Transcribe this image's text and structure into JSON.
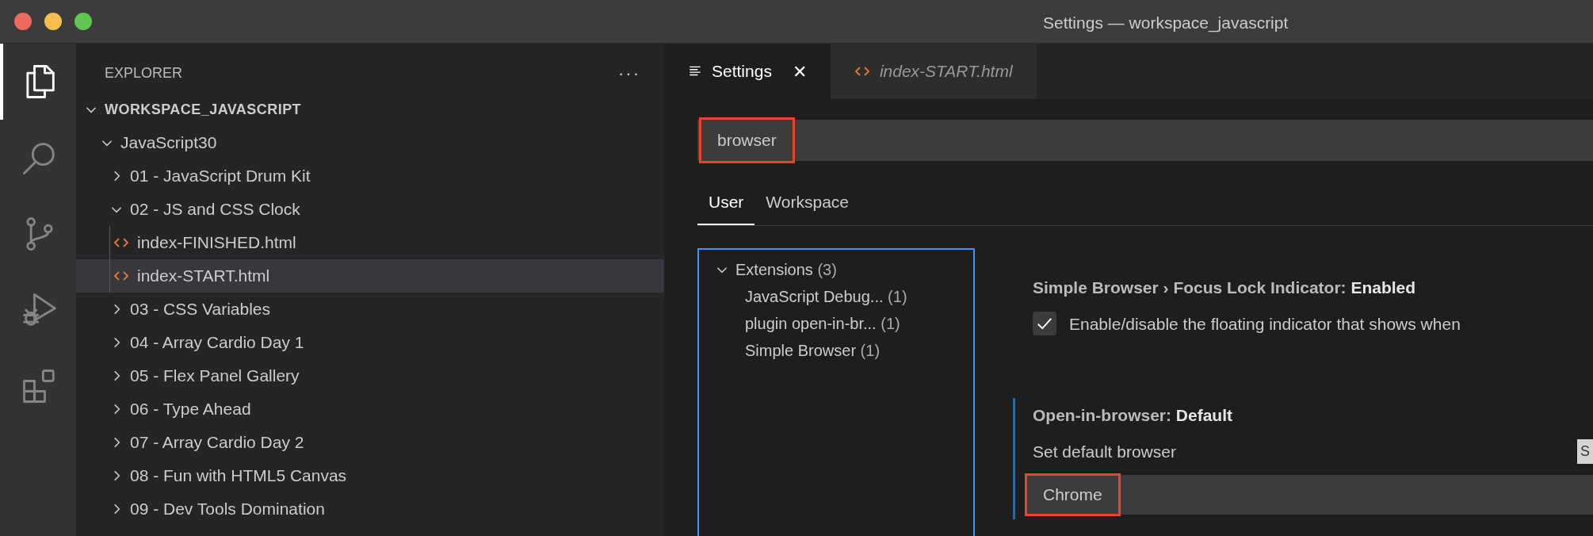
{
  "window": {
    "title": "Settings — workspace_javascript"
  },
  "activity_bar": [
    {
      "kind": "files",
      "selected": true
    },
    {
      "kind": "search",
      "selected": false
    },
    {
      "kind": "scm",
      "selected": false
    },
    {
      "kind": "debug",
      "selected": false
    },
    {
      "kind": "extensions",
      "selected": false
    }
  ],
  "explorer": {
    "title": "EXPLORER",
    "more": "···",
    "tree": [
      {
        "label": "WORKSPACE_JAVASCRIPT",
        "kind": "root",
        "expanded": true,
        "selected": false,
        "children": [
          {
            "label": "JavaScript30",
            "kind": "folder",
            "expanded": true,
            "selected": false,
            "children": [
              {
                "label": "01 - JavaScript Drum Kit",
                "kind": "folder",
                "expanded": false,
                "selected": false
              },
              {
                "label": "02 - JS and CSS Clock",
                "kind": "folder",
                "expanded": true,
                "selected": false,
                "children": [
                  {
                    "label": "index-FINISHED.html",
                    "kind": "file",
                    "selected": false
                  },
                  {
                    "label": "index-START.html",
                    "kind": "file",
                    "selected": true
                  }
                ]
              },
              {
                "label": "03 - CSS Variables",
                "kind": "folder",
                "expanded": false,
                "selected": false
              },
              {
                "label": "04 - Array Cardio Day 1",
                "kind": "folder",
                "expanded": false,
                "selected": false
              },
              {
                "label": "05 - Flex Panel Gallery",
                "kind": "folder",
                "expanded": false,
                "selected": false
              },
              {
                "label": "06 - Type Ahead",
                "kind": "folder",
                "expanded": false,
                "selected": false
              },
              {
                "label": "07 - Array Cardio Day 2",
                "kind": "folder",
                "expanded": false,
                "selected": false
              },
              {
                "label": "08 - Fun with HTML5 Canvas",
                "kind": "folder",
                "expanded": false,
                "selected": false
              },
              {
                "label": "09 - Dev Tools Domination",
                "kind": "folder",
                "expanded": false,
                "selected": false
              }
            ]
          }
        ]
      }
    ]
  },
  "editor_tabs": [
    {
      "label": "Settings",
      "kind": "settings",
      "selected": true,
      "close": "✕"
    },
    {
      "label": "index-START.html",
      "kind": "file",
      "selected": false
    }
  ],
  "settings": {
    "search": {
      "value": "browser",
      "annotated": true
    },
    "scope_tabs": [
      {
        "label": "User",
        "selected": true
      },
      {
        "label": "Workspace",
        "selected": false
      }
    ],
    "toc": [
      {
        "label": "Extensions",
        "count": "(3)",
        "expanded": true,
        "children": [
          {
            "label": "JavaScript Debug...",
            "count": "(1)"
          },
          {
            "label": "plugin open-in-br...",
            "count": "(1)"
          },
          {
            "label": "Simple Browser",
            "count": "(1)"
          }
        ]
      }
    ],
    "items": [
      {
        "kind": "checkbox",
        "path": "Simple Browser › Focus Lock Indicator: ",
        "name": "Enabled",
        "focused": false,
        "checked": true,
        "description": "Enable/disable the floating indicator that shows when"
      },
      {
        "kind": "dropdown",
        "path": "Open-in-browser: ",
        "name": "Default",
        "focused": true,
        "description": "Set default browser",
        "value": "Chrome",
        "annotated": true,
        "side_button": "S"
      }
    ]
  }
}
